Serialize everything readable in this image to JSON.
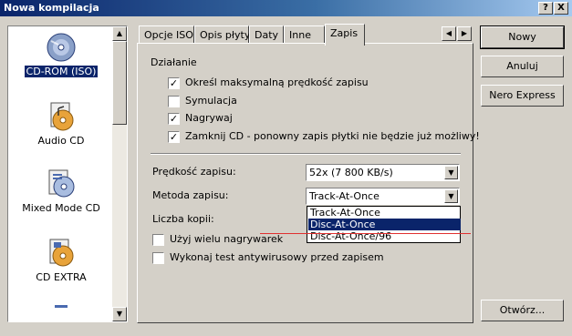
{
  "window": {
    "title": "Nowa kompilacja",
    "help_glyph": "?",
    "close_glyph": "X"
  },
  "left_list": {
    "items": [
      {
        "label": "CD-ROM (ISO)",
        "icon": "cd-rom-iso-icon",
        "selected": true
      },
      {
        "label": "Audio CD",
        "icon": "audio-cd-icon",
        "selected": false
      },
      {
        "label": "Mixed Mode CD",
        "icon": "mixed-mode-cd-icon",
        "selected": false
      },
      {
        "label": "CD EXTRA",
        "icon": "cd-extra-icon",
        "selected": false
      }
    ]
  },
  "tabs": [
    {
      "label": "Opcje ISO",
      "active": false
    },
    {
      "label": "Opis płyty",
      "active": false
    },
    {
      "label": "Daty",
      "active": false
    },
    {
      "label": "Inne",
      "active": false
    },
    {
      "label": "Zapis",
      "active": true
    }
  ],
  "panel": {
    "group_label": "Działanie",
    "checkboxes": [
      {
        "label": "Określ maksymalną prędkość zapisu",
        "checked": true
      },
      {
        "label": "Symulacja",
        "checked": false
      },
      {
        "label": "Nagrywaj",
        "checked": true
      },
      {
        "label": "Zamknij CD - ponowny zapis płytki nie będzie już możliwy!",
        "checked": true
      }
    ],
    "speed": {
      "label": "Prędkość zapisu:",
      "value": "52x (7 800 KB/s)"
    },
    "method": {
      "label": "Metoda zapisu:",
      "value": "Track-At-Once",
      "options": [
        "Track-At-Once",
        "Disc-At-Once",
        "Disc-At-Once/96"
      ],
      "highlighted_index": 1
    },
    "copies_label": "Liczba kopii:",
    "multi_recorder": {
      "label": "Użyj wielu nagrywarek",
      "checked": false
    },
    "antivirus": {
      "label": "Wykonaj test antywirusowy przed zapisem",
      "checked": false
    }
  },
  "buttons": {
    "new": "Nowy",
    "cancel": "Anuluj",
    "nero_express": "Nero Express",
    "open": "Otwórz..."
  },
  "colors": {
    "selection": "#0a246a",
    "face": "#d4d0c8",
    "annotation_line": "#e03030"
  }
}
